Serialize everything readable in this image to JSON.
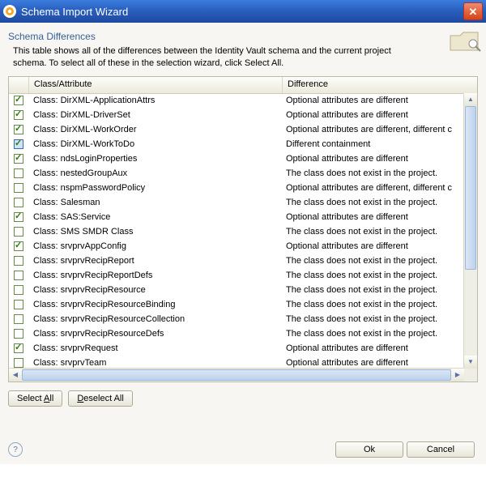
{
  "window": {
    "title": "Schema Import Wizard"
  },
  "section": {
    "title": "Schema Differences",
    "help": "This table shows all of the differences between the Identity Vault schema and the current project schema.  To select all of these in the selection wizard, click Select All."
  },
  "columns": {
    "c1": "Class/Attribute",
    "c2": "Difference"
  },
  "rows": [
    {
      "checked": true,
      "selected": false,
      "c1": "Class: DirXML-ApplicationAttrs",
      "c2": "Optional attributes are different"
    },
    {
      "checked": true,
      "selected": false,
      "c1": "Class: DirXML-DriverSet",
      "c2": "Optional attributes are different"
    },
    {
      "checked": true,
      "selected": false,
      "c1": "Class: DirXML-WorkOrder",
      "c2": "Optional attributes are different, different c"
    },
    {
      "checked": true,
      "selected": true,
      "c1": "Class: DirXML-WorkToDo",
      "c2": "Different containment"
    },
    {
      "checked": true,
      "selected": false,
      "c1": "Class: ndsLoginProperties",
      "c2": "Optional attributes are different"
    },
    {
      "checked": false,
      "selected": false,
      "c1": "Class: nestedGroupAux",
      "c2": "The class does not exist in the project."
    },
    {
      "checked": false,
      "selected": false,
      "c1": "Class: nspmPasswordPolicy",
      "c2": "Optional attributes are different, different c"
    },
    {
      "checked": false,
      "selected": false,
      "c1": "Class: Salesman",
      "c2": "The class does not exist in the project."
    },
    {
      "checked": true,
      "selected": false,
      "c1": "Class: SAS:Service",
      "c2": "Optional attributes are different"
    },
    {
      "checked": false,
      "selected": false,
      "c1": "Class: SMS SMDR Class",
      "c2": "The class does not exist in the project."
    },
    {
      "checked": true,
      "selected": false,
      "c1": "Class: srvprvAppConfig",
      "c2": "Optional attributes are different"
    },
    {
      "checked": false,
      "selected": false,
      "c1": "Class: srvprvRecipReport",
      "c2": "The class does not exist in the project."
    },
    {
      "checked": false,
      "selected": false,
      "c1": "Class: srvprvRecipReportDefs",
      "c2": "The class does not exist in the project."
    },
    {
      "checked": false,
      "selected": false,
      "c1": "Class: srvprvRecipResource",
      "c2": "The class does not exist in the project."
    },
    {
      "checked": false,
      "selected": false,
      "c1": "Class: srvprvRecipResourceBinding",
      "c2": "The class does not exist in the project."
    },
    {
      "checked": false,
      "selected": false,
      "c1": "Class: srvprvRecipResourceCollection",
      "c2": "The class does not exist in the project."
    },
    {
      "checked": false,
      "selected": false,
      "c1": "Class: srvprvRecipResourceDefs",
      "c2": "The class does not exist in the project."
    },
    {
      "checked": true,
      "selected": false,
      "c1": "Class: srvprvRequest",
      "c2": "Optional attributes are different"
    },
    {
      "checked": false,
      "selected": false,
      "c1": "Class: srvprvTeam",
      "c2": "Optional attributes are different"
    }
  ],
  "buttons": {
    "select_all": "Select All",
    "deselect_all": "Deselect All",
    "ok": "Ok",
    "cancel": "Cancel"
  }
}
